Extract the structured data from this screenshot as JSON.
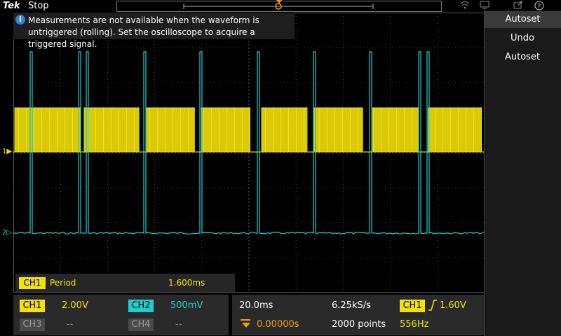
{
  "topbar": {
    "brand": "Tek",
    "run_state": "Stop",
    "trigger_marker": "T"
  },
  "banner": {
    "icon": "info-icon",
    "text": "Measurements are not available when the waveform is untriggered (rolling). Set the oscilloscope to acquire a triggered signal."
  },
  "menu": {
    "title": "Autoset",
    "undo_label": "Undo",
    "autoset_label": "Autoset"
  },
  "measurement": {
    "channel": "CH1",
    "name": "Period",
    "value": "1.600ms"
  },
  "channels": {
    "ch1": {
      "label": "CH1",
      "scale": "2.00V",
      "color": "#f4e10b",
      "marker": "1"
    },
    "ch2": {
      "label": "CH2",
      "scale": "500mV",
      "color": "#1fcfcf",
      "marker": "2"
    },
    "ch3": {
      "label": "CH3",
      "scale": "--"
    },
    "ch4": {
      "label": "CH4",
      "scale": "--"
    }
  },
  "horizontal": {
    "scale": "20.0ms",
    "sample_rate": "6.25kS/s",
    "position": "0.00000s",
    "record_length": "2000 points"
  },
  "trigger": {
    "source": "CH1",
    "level": "1.60V",
    "frequency": "556Hz"
  }
}
